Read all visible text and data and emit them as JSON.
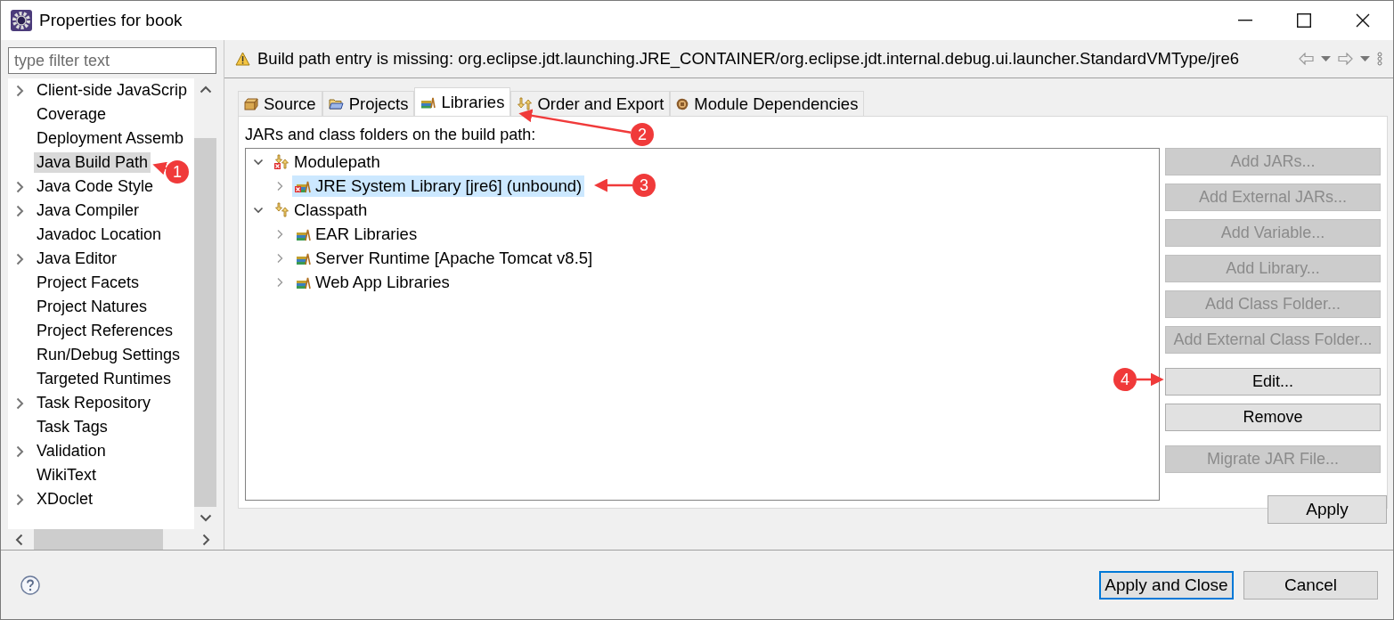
{
  "window": {
    "title": "Properties for book"
  },
  "filter": {
    "placeholder": "type filter text"
  },
  "sidebar": {
    "items": [
      {
        "label": "Client-side JavaScrip",
        "expandable": true,
        "selected": false
      },
      {
        "label": "Coverage",
        "expandable": false,
        "selected": false
      },
      {
        "label": "Deployment Assemb",
        "expandable": false,
        "selected": false
      },
      {
        "label": "Java Build Path",
        "expandable": false,
        "selected": true
      },
      {
        "label": "Java Code Style",
        "expandable": true,
        "selected": false
      },
      {
        "label": "Java Compiler",
        "expandable": true,
        "selected": false
      },
      {
        "label": "Javadoc Location",
        "expandable": false,
        "selected": false
      },
      {
        "label": "Java Editor",
        "expandable": true,
        "selected": false
      },
      {
        "label": "Project Facets",
        "expandable": false,
        "selected": false
      },
      {
        "label": "Project Natures",
        "expandable": false,
        "selected": false
      },
      {
        "label": "Project References",
        "expandable": false,
        "selected": false
      },
      {
        "label": "Run/Debug Settings",
        "expandable": false,
        "selected": false
      },
      {
        "label": "Targeted Runtimes",
        "expandable": false,
        "selected": false
      },
      {
        "label": "Task Repository",
        "expandable": true,
        "selected": false
      },
      {
        "label": "Task Tags",
        "expandable": false,
        "selected": false
      },
      {
        "label": "Validation",
        "expandable": true,
        "selected": false
      },
      {
        "label": "WikiText",
        "expandable": false,
        "selected": false
      },
      {
        "label": "XDoclet",
        "expandable": true,
        "selected": false
      }
    ]
  },
  "message": "Build path entry is missing: org.eclipse.jdt.launching.JRE_CONTAINER/org.eclipse.jdt.internal.debug.ui.launcher.StandardVMType/jre6",
  "tabs": [
    {
      "label": "Source",
      "kind": "source",
      "selected": false
    },
    {
      "label": "Projects",
      "kind": "projects",
      "selected": false
    },
    {
      "label": "Libraries",
      "kind": "libraries",
      "selected": true
    },
    {
      "label": "Order and Export",
      "kind": "order",
      "selected": false
    },
    {
      "label": "Module Dependencies",
      "kind": "module",
      "selected": false
    }
  ],
  "tree_label": "JARs and class folders on the build path:",
  "tree": [
    {
      "label": "Modulepath",
      "kind": "container",
      "error": true,
      "expanded": true,
      "selected": false,
      "children": [
        {
          "label": "JRE System Library [jre6] (unbound)",
          "kind": "library",
          "error": true,
          "expanded": false,
          "selected": true
        }
      ]
    },
    {
      "label": "Classpath",
      "kind": "container",
      "error": false,
      "expanded": true,
      "selected": false,
      "children": [
        {
          "label": "EAR Libraries",
          "kind": "library",
          "error": false,
          "expanded": false,
          "selected": false
        },
        {
          "label": "Server Runtime [Apache Tomcat v8.5]",
          "kind": "library",
          "error": false,
          "expanded": false,
          "selected": false
        },
        {
          "label": "Web App Libraries",
          "kind": "library",
          "error": false,
          "expanded": false,
          "selected": false
        }
      ]
    }
  ],
  "side_button_groups": [
    [
      {
        "label": "Add JARs...",
        "disabled": true
      },
      {
        "label": "Add External JARs...",
        "disabled": true
      },
      {
        "label": "Add Variable...",
        "disabled": true
      },
      {
        "label": "Add Library...",
        "disabled": true
      },
      {
        "label": "Add Class Folder...",
        "disabled": true
      },
      {
        "label": "Add External Class Folder...",
        "disabled": true
      }
    ],
    [
      {
        "label": "Edit...",
        "disabled": false
      },
      {
        "label": "Remove",
        "disabled": false
      }
    ],
    [
      {
        "label": "Migrate JAR File...",
        "disabled": true
      }
    ]
  ],
  "apply_button": "Apply",
  "footer_buttons": [
    {
      "label": "Apply and Close",
      "default": true
    },
    {
      "label": "Cancel",
      "default": false
    }
  ],
  "annotations": [
    {
      "number": "1"
    },
    {
      "number": "2"
    },
    {
      "number": "3"
    },
    {
      "number": "4"
    }
  ]
}
